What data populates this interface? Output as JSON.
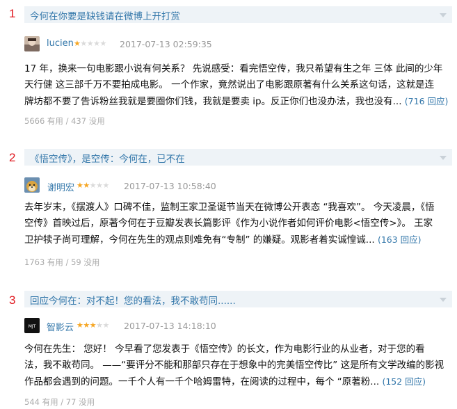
{
  "reviews": [
    {
      "index": "1",
      "title": "今何在你要是缺钱请在微博上开打赏",
      "username": "lucien",
      "rating": 1,
      "rating_max": 5,
      "timestamp": "2017-07-13 02:59:35",
      "lines": [
        "17 年，换来一句电影跟小说有何关系？ 先说感受：看完悟空传，我只希望有生之年 三体 此间的少年",
        "天行健 这三部千万不要拍成电影。 一个作家，竟然说出了电影跟原著有什么关系这句话，这就是连",
        "牌坊都不要了告诉粉丝我就是要圈你们钱，我就是要卖 ip。反正你们也没办法，我也没有..."
      ],
      "reply_link": "(716 回应)",
      "useful": "5666 有用",
      "useless": "437 没用"
    },
    {
      "index": "2",
      "title": "《悟空传》，是空传：今何在，已不在",
      "username": "谢明宏",
      "rating": 2,
      "rating_max": 5,
      "timestamp": "2017-07-13 10:58:40",
      "lines": [
        "去年岁末，《摆渡人》口碑不佳，监制王家卫圣诞节当天在微博公开表态 “我喜欢”。 今天凌晨，《悟",
        "空传》首映过后，原著今何在于豆瓣发表长篇影评《作为小说作者如何评价电影<悟空传>》。 王家",
        "卫护犊子尚可理解，今何在先生的观点则难免有“专制” 的嫌疑。观影者着实诚惶诚..."
      ],
      "reply_link": "(163 回应)",
      "useful": "1763 有用",
      "useless": "59 没用"
    },
    {
      "index": "3",
      "title": "回应今何在：对不起！您的看法，我不敢苟同......",
      "username": "智影云",
      "rating": 3,
      "rating_max": 5,
      "timestamp": "2017-07-13 14:18:10",
      "lines": [
        "今何在先生： 您好！ 今早看了您发表于《悟空传》的长文，作为电影行业的从业者，对于您的看",
        "法，我不敢苟同。 ——“要评分不能和那部只存在于想象中的完美悟空传比” 这是所有文学改编的影视",
        "作品都会遇到的问题。一千个人有一千个哈姆雷特，在阅读的过程中，每个 “原著粉..."
      ],
      "reply_link": "(152 回应)",
      "useful": "544 有用",
      "useless": "77 没用"
    }
  ],
  "avatars": [
    "avatar-photo-icon",
    "doge-avatar-icon",
    "mjt-logo-icon"
  ],
  "colors": {
    "link": "#3377aa",
    "index": "#e0161d",
    "star": "#f6a623",
    "title_bg": "#eef3f7"
  }
}
